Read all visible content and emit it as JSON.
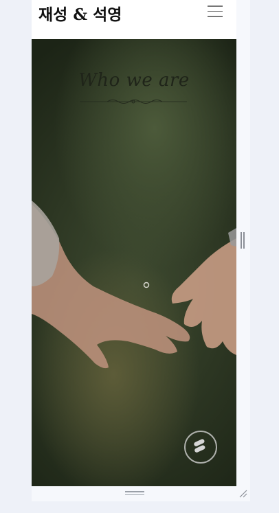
{
  "header": {
    "title": "재성 & 석영",
    "menu_icon": "hamburger-icon"
  },
  "hero": {
    "heading": "Who we are",
    "ornament_icon": "ornament-divider-icon",
    "badge_icon": "brand-logo-icon"
  },
  "window": {
    "scroll_handle_icon": "scroll-handle-icon",
    "grip_icon": "drag-grip-icon",
    "resize_icon": "resize-corner-icon"
  },
  "colors": {
    "page_bg": "#eef1f8",
    "hero_dark": "#1c2416",
    "hero_mid": "#4c5a3a",
    "skin": "#c9a089"
  }
}
